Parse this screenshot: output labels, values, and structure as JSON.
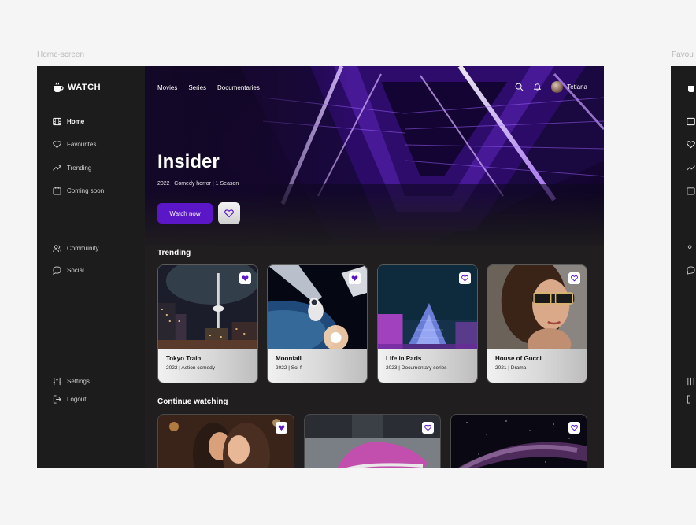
{
  "frame_labels": [
    "Home-screen",
    "Favou"
  ],
  "logo": {
    "text": "WATCH"
  },
  "sidebar": {
    "items": [
      {
        "label": "Home",
        "icon": "film-icon"
      },
      {
        "label": "Favourites",
        "icon": "heart-icon"
      },
      {
        "label": "Trending",
        "icon": "trending-icon"
      },
      {
        "label": "Coming soon",
        "icon": "calendar-icon"
      },
      {
        "label": "Community",
        "icon": "users-icon"
      },
      {
        "label": "Social",
        "icon": "chat-icon"
      },
      {
        "label": "Settings",
        "icon": "sliders-icon"
      },
      {
        "label": "Logout",
        "icon": "logout-icon"
      }
    ]
  },
  "top_nav": [
    "Movies",
    "Series",
    "Documentaries"
  ],
  "user": {
    "name": "Tetiana"
  },
  "hero": {
    "title": "Insider",
    "meta": "2022 | Comedy horror | 1 Season",
    "watch_label": "Watch now"
  },
  "trending": {
    "title": "Trending",
    "cards": [
      {
        "name": "Tokyo Train",
        "sub": "2022 | Action comedy",
        "favourite": true
      },
      {
        "name": "Moonfall",
        "sub": "2022 | Sci-fi",
        "favourite": true
      },
      {
        "name": "Life in Paris",
        "sub": "2023 | Documentary series",
        "favourite": false
      },
      {
        "name": "House of Gucci",
        "sub": "2021 | Drama",
        "favourite": false
      }
    ]
  },
  "continue_watching": {
    "title": "Continue watching",
    "cards": [
      {
        "favourite": true
      },
      {
        "favourite": false
      },
      {
        "favourite": false
      }
    ]
  },
  "colors": {
    "accent": "#5B16C8",
    "sidebar": "#1C1C1C",
    "main": "#201E1E"
  }
}
